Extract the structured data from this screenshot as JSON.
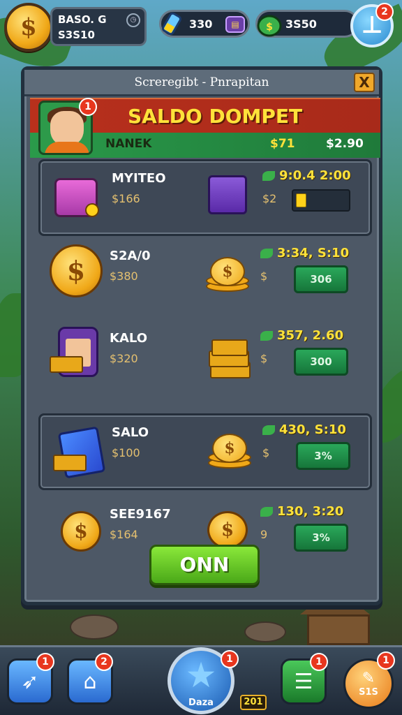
{
  "topbar": {
    "player_line1": "BASO. G",
    "player_line2": "S3S10",
    "resource_1": "330",
    "resource_2": "3S50",
    "badges": {
      "profile_action": "2"
    }
  },
  "panel": {
    "title": "Screregibt - Pnrapitan",
    "close_label": "X",
    "hero_badge": "1",
    "wallet_title": "SALDO DOMPET",
    "wallet_sub_label": "NANEK",
    "wallet_sub_mid": "$71",
    "wallet_sub_right": "$2.90"
  },
  "rows": [
    {
      "name": "MYITEO",
      "price": "$166",
      "dollar": "$2",
      "reward": "9:0.4 2:00",
      "progress": 0.2
    },
    {
      "name": "S2A/0",
      "price": "$380",
      "dollar": "$",
      "reward": "3:34, S:10",
      "button": "306"
    },
    {
      "name": "KALO",
      "price": "$320",
      "dollar": "$",
      "reward": "357, 2.60",
      "button": "300"
    },
    {
      "name": "SALO",
      "price": "$100",
      "dollar": "$",
      "reward": "430, S:10",
      "button": "3%"
    },
    {
      "name": "SEE9167",
      "price": "$164",
      "dollar": "9",
      "reward": "130, 3:20",
      "button": "3%"
    }
  ],
  "confirm_label": "ONN",
  "bottom_nav": {
    "badges": [
      "1",
      "2",
      "1",
      "1",
      "1"
    ],
    "star_label": "Daza",
    "count_label": "201",
    "last_label": "S1S"
  },
  "colors": {
    "accent_gold": "#ffe23a",
    "wallet_red": "#b8301c",
    "wallet_green": "#2a9a4a",
    "button_green": "#4aa818"
  },
  "icons": {
    "top_left": "coin-icon",
    "top_right": "wrench-icon",
    "nav": [
      "rocket-icon",
      "gold-bell-icon",
      "star-icon",
      "ledger-icon",
      "coupon-icon"
    ]
  }
}
